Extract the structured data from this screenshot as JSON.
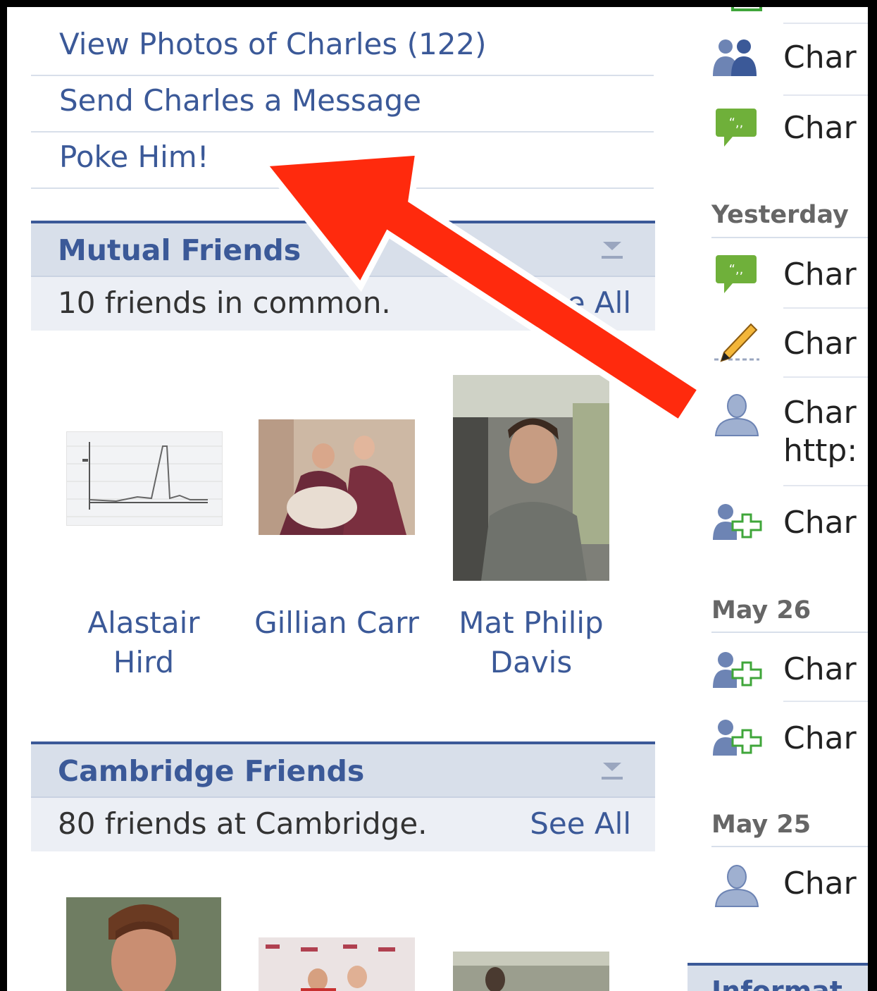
{
  "actions": [
    {
      "label": "View Photos of Charles (122)"
    },
    {
      "label": "Send Charles a Message"
    },
    {
      "label": "Poke Him!"
    }
  ],
  "mutual": {
    "title": "Mutual  Friends",
    "count": "10 friends in common.",
    "see_all": "See All",
    "friends": [
      {
        "name": "Alastair Hird"
      },
      {
        "name": "Gillian Carr"
      },
      {
        "name": "Mat Philip Davis"
      }
    ]
  },
  "cambridge": {
    "title": "Cambridge Friends",
    "count": "80 friends at Cambridge.",
    "see_all": "See All"
  },
  "feed": {
    "top_items": [
      {
        "icon": "group-icon",
        "text": "Char"
      },
      {
        "icon": "comment-bubble-icon",
        "text": "Char"
      }
    ],
    "groups": [
      {
        "date": "Yesterday",
        "items": [
          {
            "icon": "comment-bubble-icon",
            "text": "Char"
          },
          {
            "icon": "pencil-icon",
            "text": "Char"
          },
          {
            "icon": "user-silhouette-icon",
            "text": "Char",
            "text2": "http:"
          },
          {
            "icon": "add-friend-icon",
            "text": "Char"
          }
        ]
      },
      {
        "date": "May 26",
        "items": [
          {
            "icon": "add-friend-icon",
            "text": "Char"
          },
          {
            "icon": "add-friend-icon",
            "text": "Char"
          }
        ]
      },
      {
        "date": "May 25",
        "items": [
          {
            "icon": "user-silhouette-icon",
            "text": "Char"
          }
        ]
      }
    ],
    "bottom_box_title": "Informat"
  },
  "colors": {
    "link": "#3b5998",
    "header_bg": "#d8dfea",
    "arrow": "#ff2a0d",
    "comment_icon": "#6fb03a",
    "add_friend_icon": "#3fa63a"
  }
}
